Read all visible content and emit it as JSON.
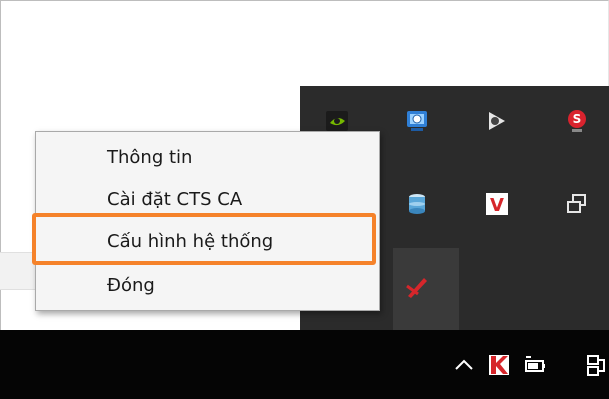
{
  "context_menu": {
    "items": [
      {
        "label": "Thông tin"
      },
      {
        "label": "Cài đặt CTS CA"
      },
      {
        "label": "Cấu hình hệ thống"
      },
      {
        "label": "Đóng"
      }
    ],
    "highlighted_index": 2,
    "highlight_color": "#f5822a"
  },
  "tray_flyout": {
    "icons": [
      "nvidia-icon",
      "network-monitor-icon",
      "speaker-app-icon",
      "s-app-icon",
      "database-icon",
      "vietnamese-keyboard-icon",
      "device-icon",
      "pen-icon"
    ]
  },
  "taskbar": {
    "icons": [
      "chevron-up-icon",
      "kaspersky-icon",
      "battery-icon",
      "network-icon"
    ]
  },
  "colors": {
    "taskbar_bg": "#050505",
    "flyout_bg": "#2b2b2b",
    "menu_bg": "#f5f5f5"
  }
}
